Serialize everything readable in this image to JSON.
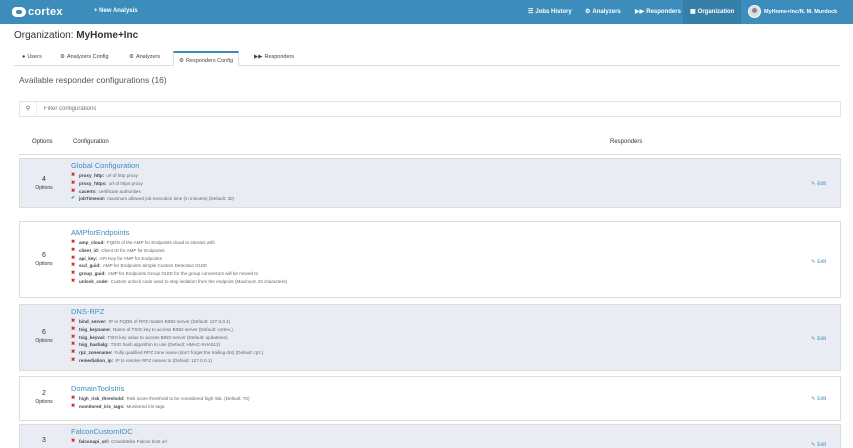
{
  "header": {
    "logo": "cortex",
    "new_analysis": "+ New Analysis",
    "nav": [
      {
        "label": "Jobs History",
        "icon": "tasks-icon"
      },
      {
        "label": "Analyzers",
        "icon": "cogs-icon"
      },
      {
        "label": "Responders",
        "icon": "forward-icon"
      },
      {
        "label": "Organization",
        "icon": "building-icon"
      }
    ],
    "user": "MyHome+Inc/N. M. Murdock"
  },
  "page": {
    "title_prefix": "Organization: ",
    "title_org": "MyHome+Inc"
  },
  "tabs": [
    {
      "label": "Users",
      "icon": "user-icon"
    },
    {
      "label": "Analyzers Config",
      "icon": "gear-icon"
    },
    {
      "label": "Analyzers",
      "icon": "cogs-icon"
    },
    {
      "label": "Responders Config",
      "icon": "gear-icon"
    },
    {
      "label": "Responders",
      "icon": "forward-icon"
    }
  ],
  "section": {
    "title": "Available responder configurations (16)"
  },
  "filter": {
    "placeholder": "Filter configurations"
  },
  "columns": {
    "options": "Options",
    "configuration": "Configuration",
    "responders": "Responders"
  },
  "edit_label": "Edit",
  "rows": [
    {
      "count": "4",
      "label": "Options",
      "title": "Global Configuration",
      "lines": [
        {
          "mark": "x",
          "key": "proxy_http:",
          "desc": "url of http proxy"
        },
        {
          "mark": "x",
          "key": "proxy_https:",
          "desc": "url of https proxy"
        },
        {
          "mark": "x",
          "key": "cacerts:",
          "desc": "certificate authorities"
        },
        {
          "mark": "ok",
          "key": "jobTimeout:",
          "desc": "maximum allowed job execution time (in minutes) (Default: 30)"
        }
      ]
    },
    {
      "count": "6",
      "label": "Options",
      "title": "AMPforEndpoints",
      "lines": [
        {
          "mark": "x",
          "key": "amp_cloud:",
          "desc": "FQDN of the AMP for Endpoints cloud to interact with"
        },
        {
          "mark": "x",
          "key": "client_id:",
          "desc": "Client ID for AMP for Endpoints"
        },
        {
          "mark": "x",
          "key": "api_key:",
          "desc": "API Key for AMP for Endpoints"
        },
        {
          "mark": "x",
          "key": "scd_guid:",
          "desc": "AMP for Endpoints Simple Custom Detection GUID"
        },
        {
          "mark": "x",
          "key": "group_guid:",
          "desc": "AMP for Endpoints Group GUID for the group connectors will be moved to"
        },
        {
          "mark": "x",
          "key": "unlock_code:",
          "desc": "Custom unlock code used to stop isolation from the endpoint (Maximum 24 characters)"
        }
      ]
    },
    {
      "count": "6",
      "label": "Options",
      "title": "DNS-RPZ",
      "lines": [
        {
          "mark": "x",
          "key": "bind_server:",
          "desc": "IP or FQDN of RPZ master BIND server (Default: 127.0.0.1)"
        },
        {
          "mark": "x",
          "key": "tsig_keyname:",
          "desc": "Name of TSIG key to access BIND server (Default: cortex.)"
        },
        {
          "mark": "x",
          "key": "tsig_keyval:",
          "desc": "TSIG key value to access BIND server (Default: updateme)"
        },
        {
          "mark": "x",
          "key": "tsig_hashalg:",
          "desc": "TSIG hash algorithm to use (Default: HMAC-SHA512)"
        },
        {
          "mark": "x",
          "key": "rpz_zonename:",
          "desc": "Fully qualified RPZ zone name (don't forget the trailing dot) (Default: rpz.)"
        },
        {
          "mark": "x",
          "key": "remediation_ip:",
          "desc": "IP to resolve RPZ names to (Default: 127.0.0.1)"
        }
      ]
    },
    {
      "count": "2",
      "label": "Options",
      "title": "DomainToolsIris",
      "lines": [
        {
          "mark": "x",
          "key": "high_risk_threshold:",
          "desc": "Risk score threshold to be considered high risk. (Default: 70)"
        },
        {
          "mark": "x",
          "key": "monitored_iris_tags:",
          "desc": "Monitored Iris tags."
        }
      ]
    },
    {
      "count": "3",
      "label": "Options",
      "title": "FalconCustomIOC",
      "lines": [
        {
          "mark": "x",
          "key": "falconapi_url:",
          "desc": "Crowdstrike Falcon host url"
        }
      ]
    }
  ]
}
